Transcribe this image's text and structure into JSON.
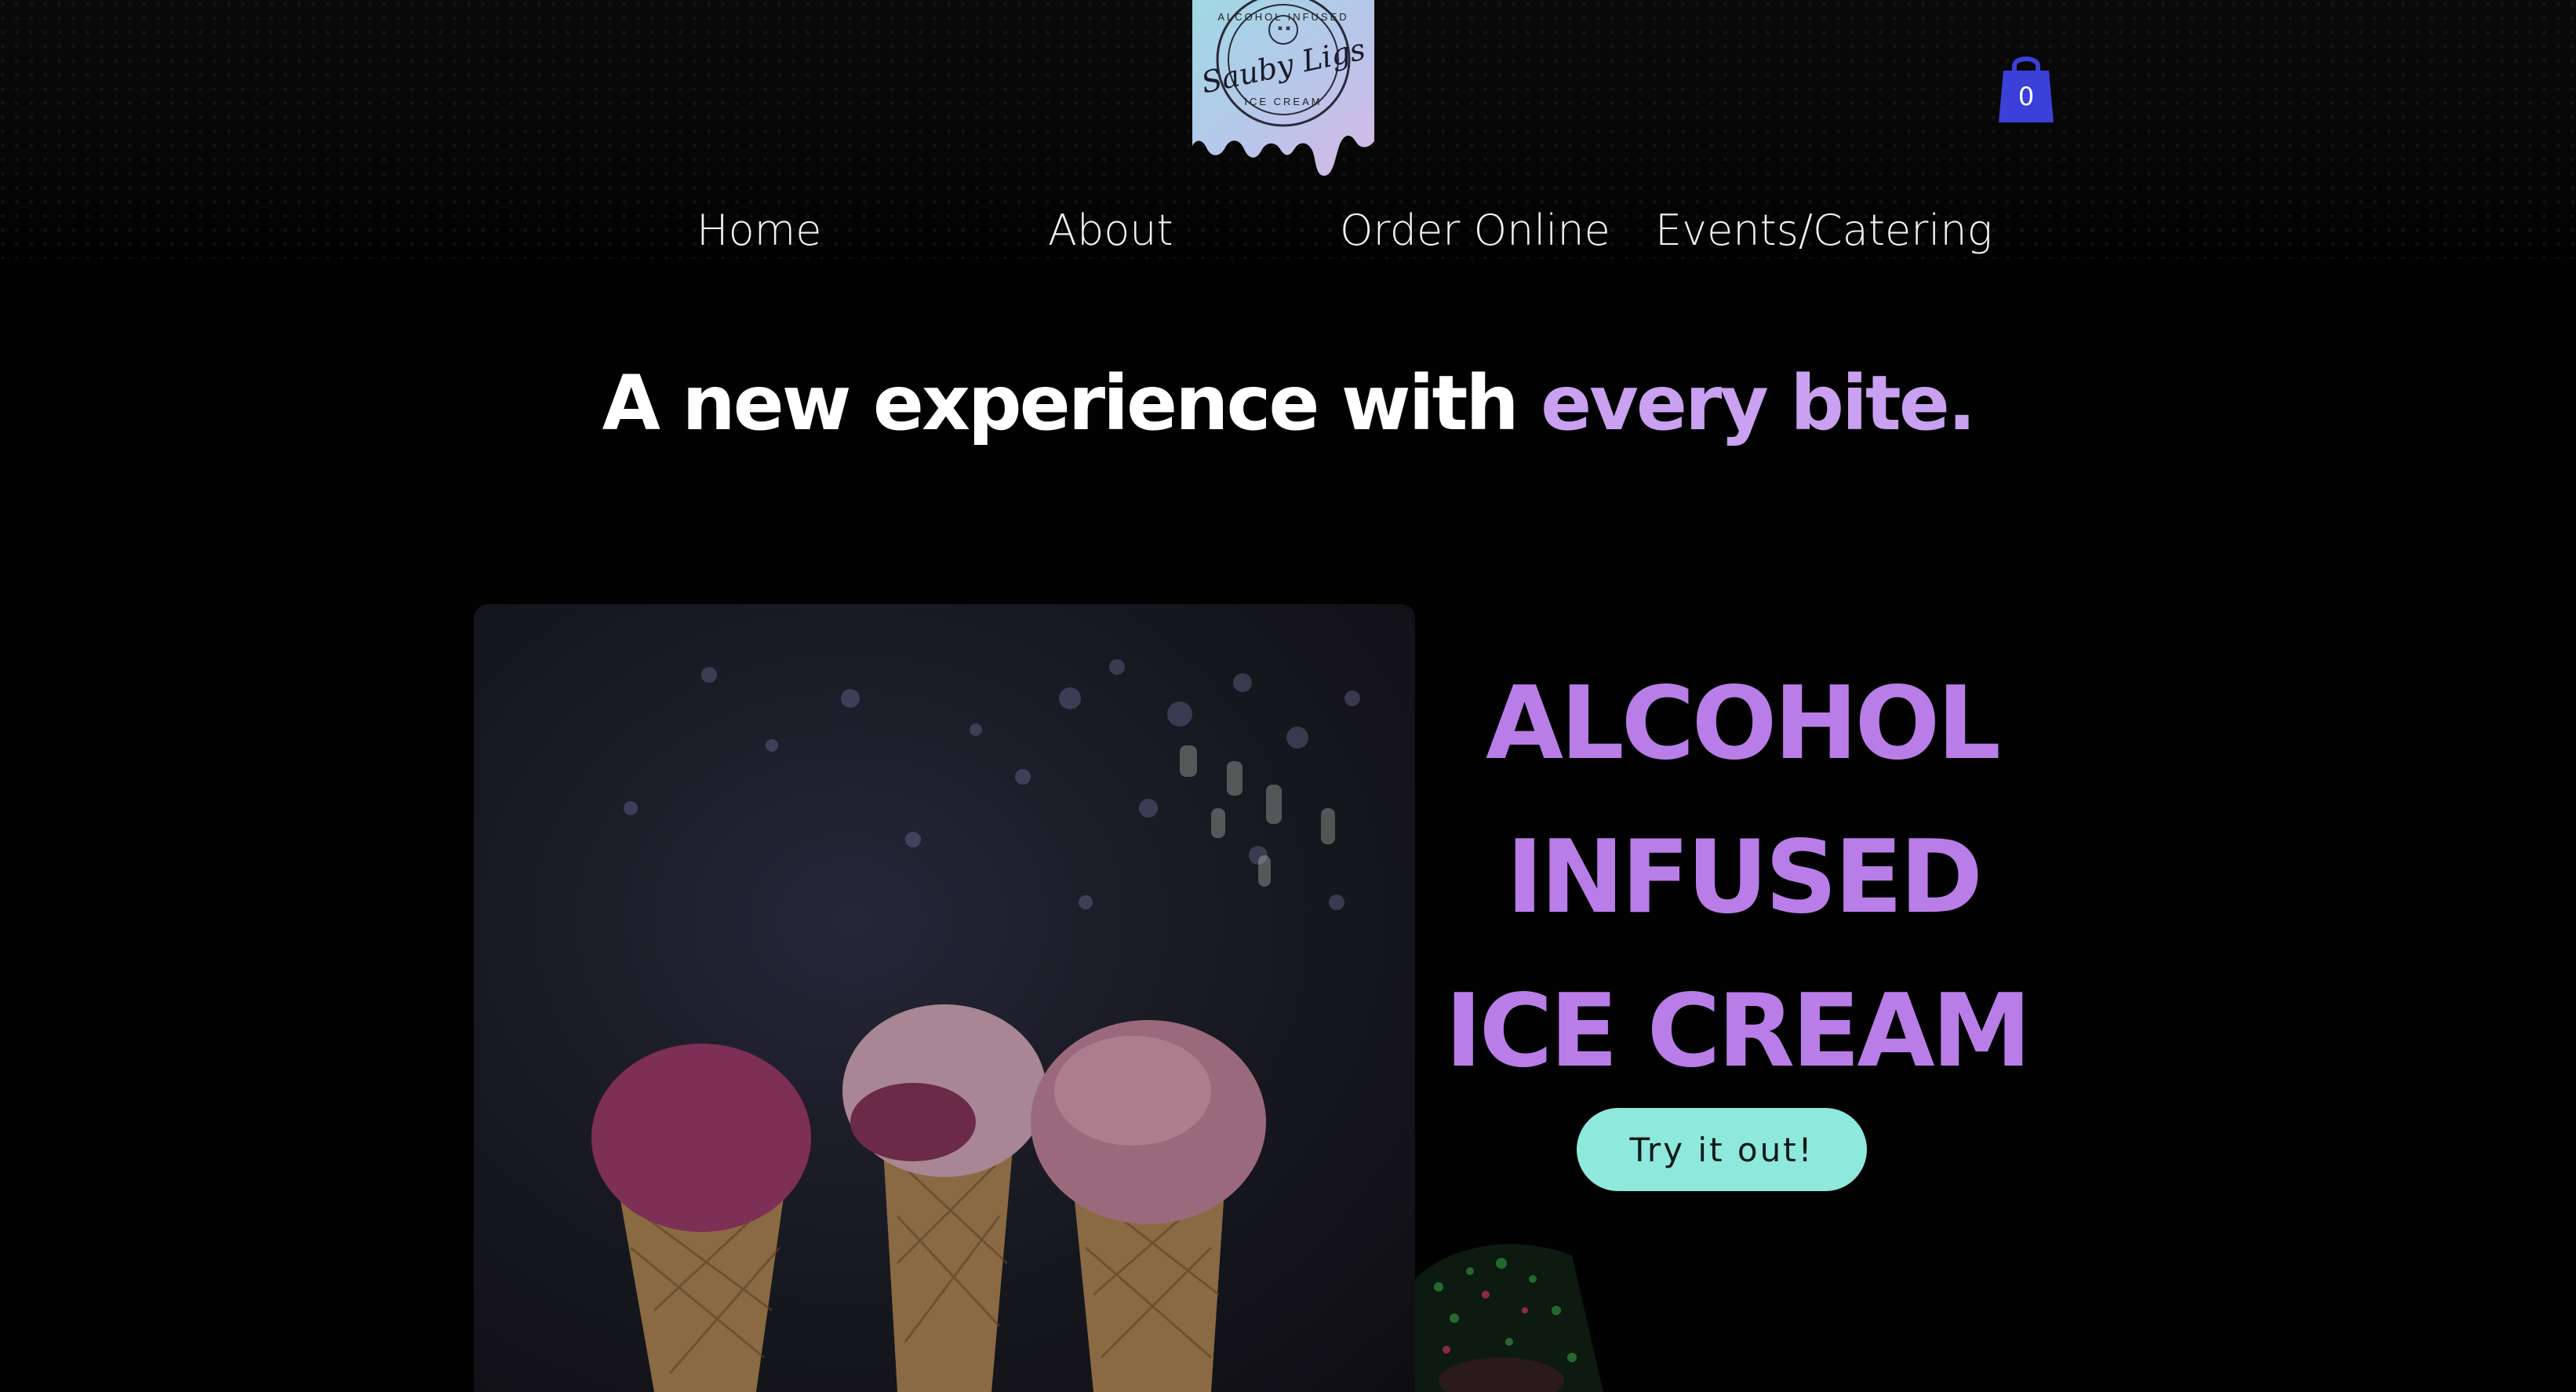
{
  "brand": {
    "logo_script": "Sauby Ligs",
    "logo_top_text": "ALCOHOL INFUSED",
    "logo_bottom_text": "ICE CREAM"
  },
  "cart": {
    "count": "0",
    "icon": "shopping-bag-icon",
    "color": "#3a40d8"
  },
  "nav": {
    "items": [
      {
        "label": "Home"
      },
      {
        "label": "About"
      },
      {
        "label": "Order Online"
      },
      {
        "label": "Events/Catering"
      }
    ]
  },
  "hero": {
    "headline_main": "A new experience with ",
    "headline_accent": "every bite.",
    "accent_color": "#c9a1f0",
    "lines": [
      "ALCOHOL",
      "INFUSED",
      "ICE CREAM"
    ],
    "lines_color": "#b97de8",
    "cta_label": "Try it out!",
    "cta_color": "#8fe8dc"
  }
}
